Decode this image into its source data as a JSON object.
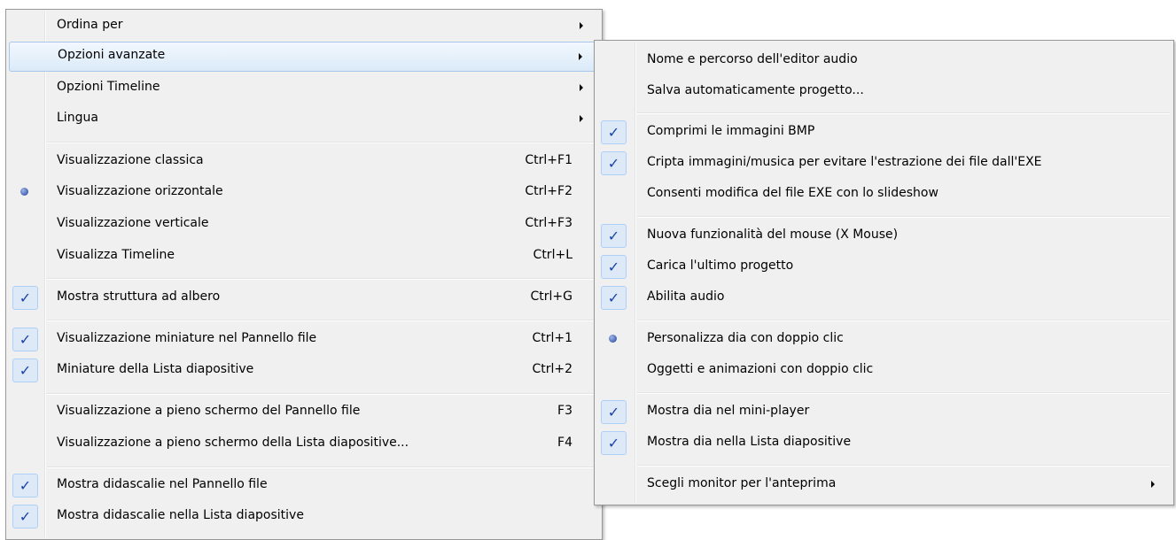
{
  "main_menu": {
    "items": [
      {
        "label": "Ordina per",
        "submenu": true
      },
      {
        "label": "Opzioni avanzate",
        "submenu": true,
        "highlighted": true
      },
      {
        "label": "Opzioni Timeline",
        "submenu": true
      },
      {
        "label": "Lingua",
        "submenu": true
      },
      {
        "label": "Visualizzazione classica",
        "shortcut": "Ctrl+F1"
      },
      {
        "label": "Visualizzazione orizzontale",
        "shortcut": "Ctrl+F2",
        "radio": true
      },
      {
        "label": "Visualizzazione verticale",
        "shortcut": "Ctrl+F3"
      },
      {
        "label": "Visualizza Timeline",
        "shortcut": "Ctrl+L"
      },
      {
        "label": "Mostra struttura ad albero",
        "shortcut": "Ctrl+G",
        "checked": true
      },
      {
        "label": "Visualizzazione miniature nel Pannello file",
        "shortcut": "Ctrl+1",
        "checked": true
      },
      {
        "label": "Miniature della Lista diapositive",
        "shortcut": "Ctrl+2",
        "checked": true
      },
      {
        "label": "Visualizzazione a pieno schermo del Pannello file",
        "shortcut": "F3"
      },
      {
        "label": "Visualizzazione a pieno schermo della Lista diapositive...",
        "shortcut": "F4"
      },
      {
        "label": "Mostra didascalie nel Pannello file",
        "checked": true
      },
      {
        "label": "Mostra didascalie nella Lista diapositive",
        "checked": true
      }
    ]
  },
  "sub_menu": {
    "items": [
      {
        "label": "Nome e percorso dell'editor audio"
      },
      {
        "label": "Salva automaticamente progetto..."
      },
      {
        "label": "Comprimi le immagini BMP",
        "checked": true
      },
      {
        "label": "Cripta immagini/musica per evitare l'estrazione dei file dall'EXE",
        "checked": true
      },
      {
        "label": "Consenti modifica del file EXE con lo slideshow"
      },
      {
        "label": "Nuova funzionalità del mouse (X Mouse)",
        "checked": true
      },
      {
        "label": "Carica l'ultimo progetto",
        "checked": true
      },
      {
        "label": "Abilita audio",
        "checked": true
      },
      {
        "label": "Personalizza dia con doppio clic",
        "radio": true
      },
      {
        "label": "Oggetti e animazioni con doppio clic"
      },
      {
        "label": "Mostra dia nel mini-player",
        "checked": true
      },
      {
        "label": "Mostra dia nella Lista diapositive",
        "checked": true
      },
      {
        "label": "Scegli monitor per l'anteprima",
        "submenu": true
      }
    ]
  },
  "icons": {
    "check": "check-icon",
    "radio": "radio-dot-icon",
    "submenu": "submenu-arrow-icon"
  },
  "colors": {
    "menu_bg": "#f0f0f0",
    "highlight_border": "#a8c7ea",
    "check_color": "#1a42a8"
  }
}
